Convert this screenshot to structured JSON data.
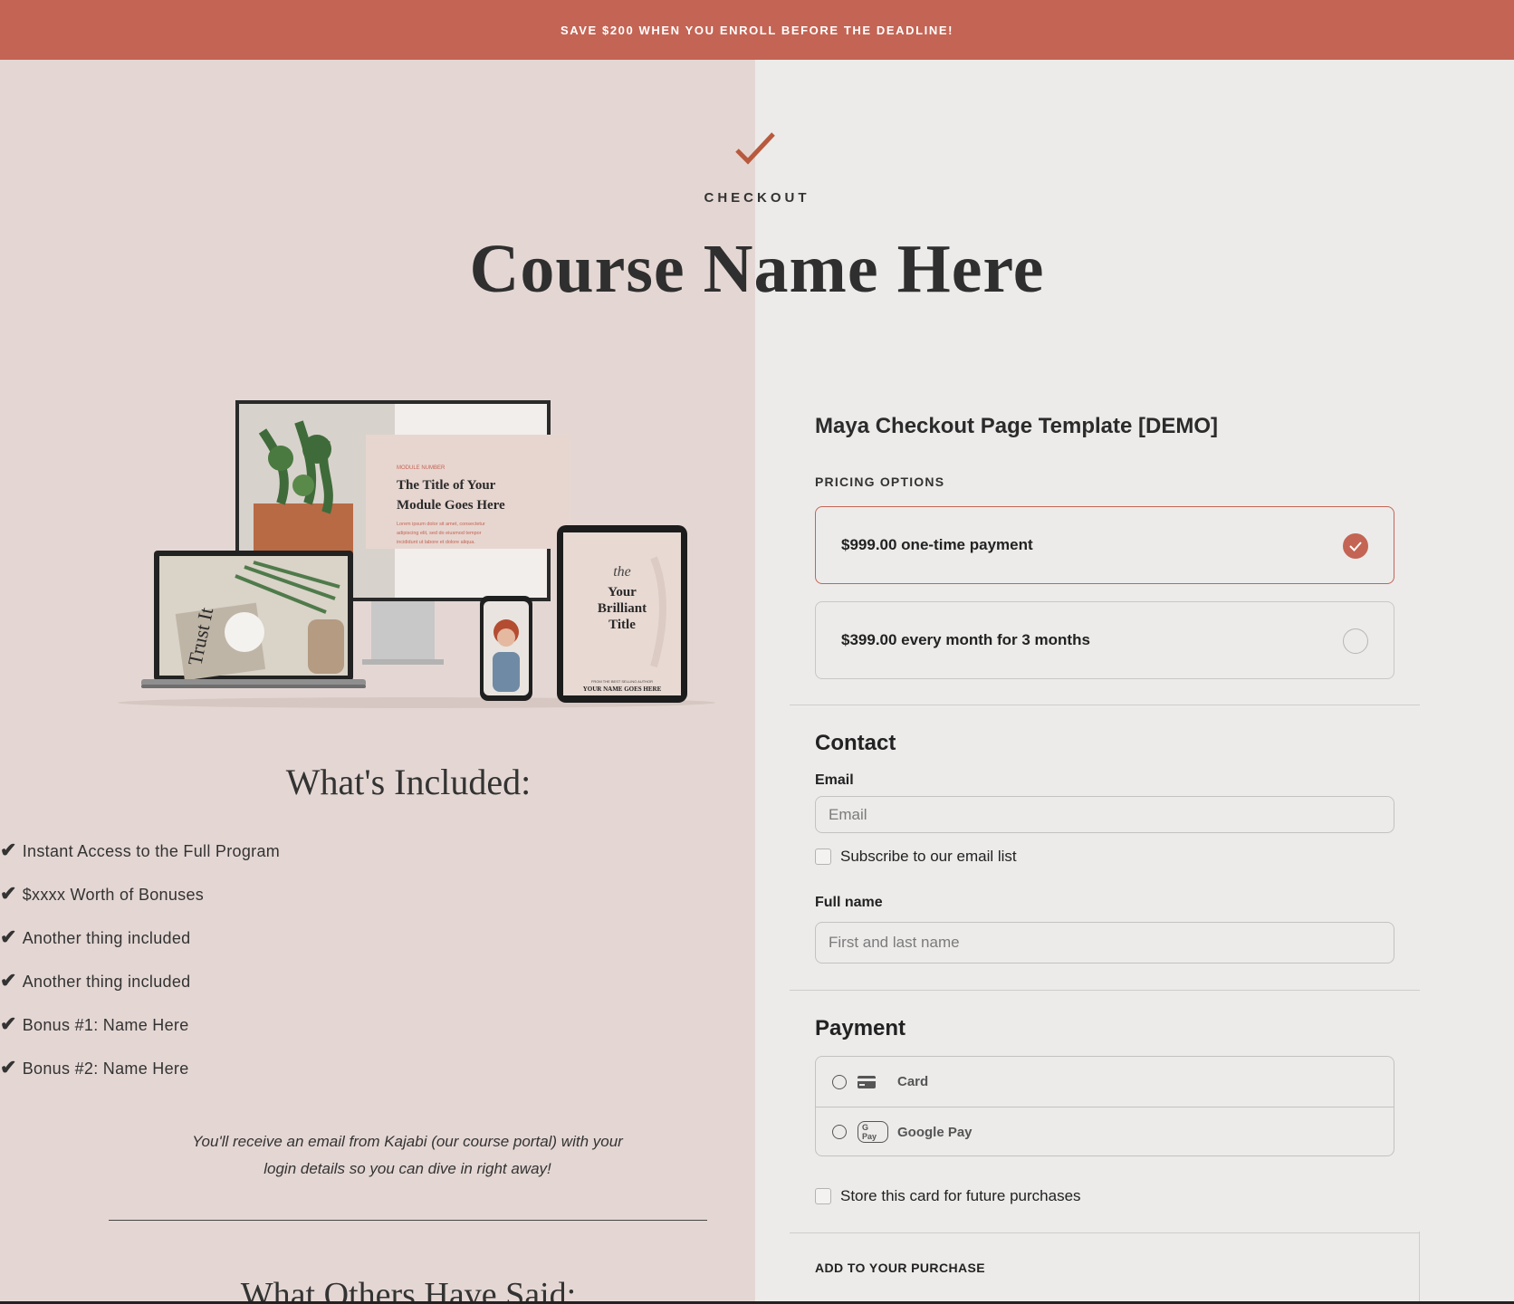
{
  "banner": {
    "text": "SAVE $200 WHEN YOU ENROLL BEFORE THE DEADLINE!"
  },
  "hero": {
    "kicker": "CHECKOUT",
    "title": "Course Name Here"
  },
  "mockup": {
    "monitor": {
      "module_number": "MODULE NUMBER",
      "module_title_1": "The Title of Your",
      "module_title_2": "Module Goes Here",
      "lorem_1": "Lorem ipsum dolor sit amet, consectetur",
      "lorem_2": "adipiscing elit, sed do eiusmod tempor",
      "lorem_3": "incididunt ut labore et dolore aliqua."
    },
    "laptop": {
      "book_text": "Trust It"
    },
    "tablet": {
      "script": "the",
      "title_1": "Your",
      "title_2": "Brilliant",
      "title_3": "Title",
      "byline_small": "FROM THE BEST SELLING AUTHOR",
      "byline": "YOUR NAME GOES HERE"
    }
  },
  "included": {
    "heading": "What's Included:",
    "tick": "✔",
    "items": [
      "Instant Access to the Full Program",
      "$xxxx Worth of Bonuses",
      "Another thing included",
      "Another thing included",
      "Bonus #1: Name Here",
      "Bonus #2: Name Here"
    ],
    "note_1": "You'll receive an email from Kajabi (our course portal) with your",
    "note_2": "login details so you can dive in right away!",
    "others_heading": "What Others Have Said:"
  },
  "checkout": {
    "product_title": "Maya Checkout Page Template [DEMO]",
    "pricing_caption": "PRICING OPTIONS",
    "pricing_options": [
      {
        "label": "$999.00 one-time payment",
        "selected": true
      },
      {
        "label": "$399.00 every month for 3 months",
        "selected": false
      }
    ],
    "contact": {
      "heading": "Contact",
      "email_label": "Email",
      "email_placeholder": "Email",
      "subscribe_label": "Subscribe to our email list",
      "name_label": "Full name",
      "name_placeholder": "First and last name"
    },
    "payment": {
      "heading": "Payment",
      "methods": [
        {
          "label": "Card",
          "icon": "credit-card-icon"
        },
        {
          "label": "Google Pay",
          "icon": "google-pay-icon",
          "badge": "G Pay"
        }
      ],
      "store_card_label": "Store this card for future purchases"
    },
    "add_caption": "ADD TO YOUR PURCHASE"
  },
  "colors": {
    "accent": "#c46454",
    "left_bg": "#e4d7d3",
    "right_bg": "#ecebea"
  }
}
